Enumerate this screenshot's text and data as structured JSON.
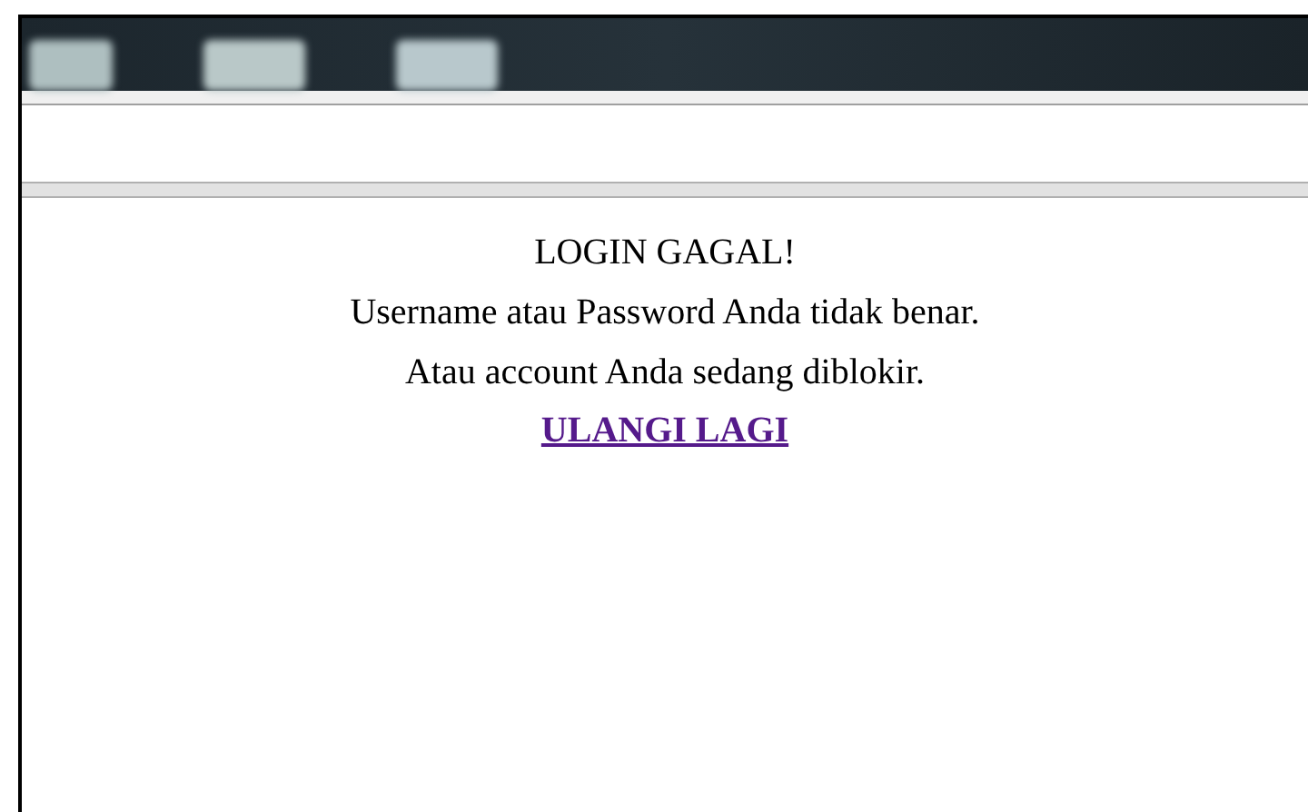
{
  "message": {
    "title": "LOGIN GAGAL!",
    "lines": [
      "Username atau Password Anda tidak benar.",
      "Atau account Anda sedang diblokir."
    ],
    "link": {
      "label": "ULANGI LAGI",
      "visited": true
    }
  }
}
